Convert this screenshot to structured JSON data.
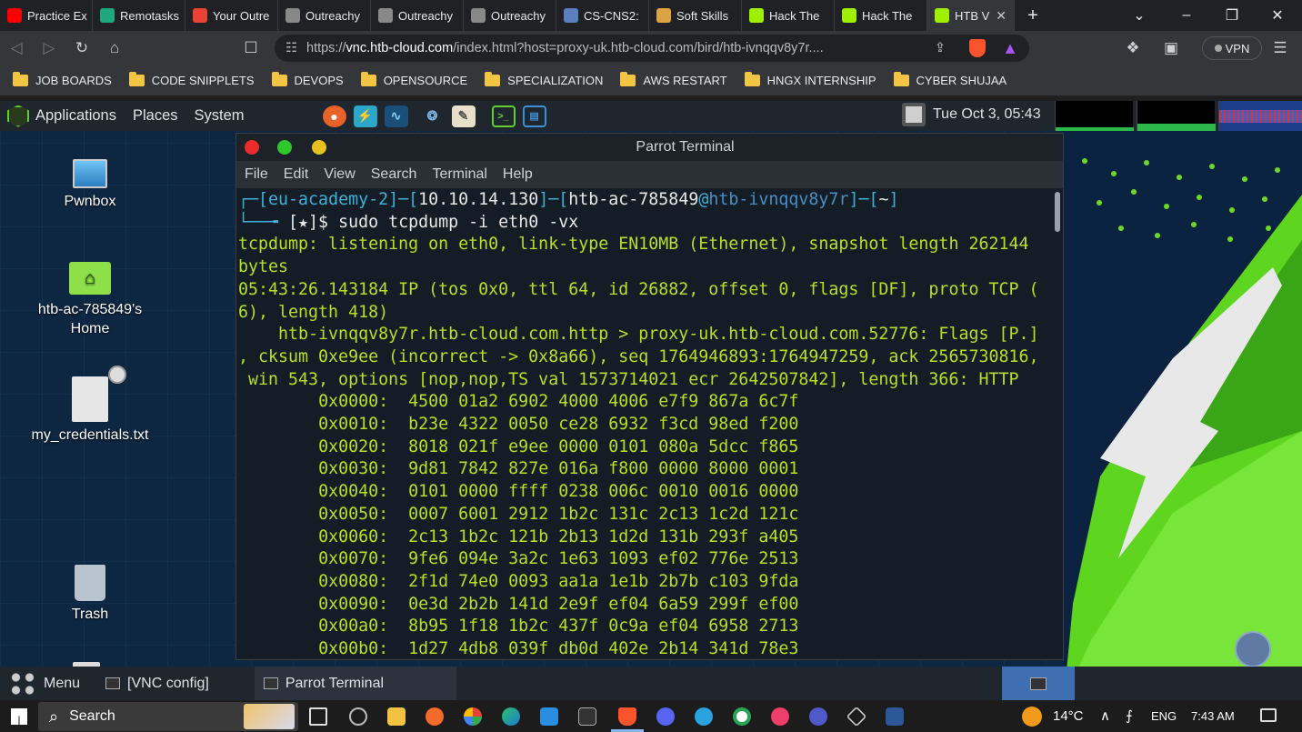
{
  "browser": {
    "tabs": [
      {
        "label": "Practice Ex",
        "icon": "youtube-icon",
        "color": "#ff0000"
      },
      {
        "label": "Remotasks",
        "icon": "remotasks-icon",
        "color": "#1fa87d"
      },
      {
        "label": "Your Outre",
        "icon": "gmail-icon",
        "color": "#ea4335"
      },
      {
        "label": "Outreachy",
        "icon": "outreachy-icon",
        "color": "#888888"
      },
      {
        "label": "Outreachy",
        "icon": "outreachy-icon",
        "color": "#888888"
      },
      {
        "label": "Outreachy",
        "icon": "outreachy-icon",
        "color": "#888888"
      },
      {
        "label": "CS-CNS2:",
        "icon": "doc-icon",
        "color": "#5b7fbf"
      },
      {
        "label": "Soft Skills",
        "icon": "doc-icon",
        "color": "#d9a441"
      },
      {
        "label": "Hack The",
        "icon": "htb-cube-icon",
        "color": "#9fef00"
      },
      {
        "label": "Hack The",
        "icon": "htb-cube-icon",
        "color": "#9fef00"
      },
      {
        "label": "HTB V",
        "icon": "htb-cube-icon",
        "color": "#9fef00",
        "active": true
      }
    ],
    "new_tab": "+",
    "url_prefix": "https://",
    "url_host": "vnc.htb-cloud.com",
    "url_rest": "/index.html?host=proxy-uk.htb-cloud.com/bird/htb-ivnqqv8y7r....",
    "vpn_label": "VPN",
    "bookmarks": [
      "JOB BOARDS",
      "CODE SNIPPLETS",
      "DEVOPS",
      "OPENSOURCE",
      "SPECIALIZATION",
      "AWS RESTART",
      "HNGX INTERNSHIP",
      "CYBER SHUJAA"
    ]
  },
  "parrot": {
    "menu": [
      "Applications",
      "Places",
      "System"
    ],
    "clock": "Tue Oct  3, 05:43",
    "desktop_icons": [
      {
        "label": "Pwnbox",
        "icon": "monitor-icon"
      },
      {
        "label": "htb-ac-785849's\nHome",
        "icon": "home-folder-icon"
      },
      {
        "label": "my_credentials.txt",
        "icon": "text-file-icon"
      },
      {
        "label": "Trash",
        "icon": "trash-icon"
      }
    ],
    "taskbar": {
      "menu_label": "Menu",
      "items": [
        "[VNC config]",
        "Parrot Terminal"
      ]
    }
  },
  "terminal": {
    "title": "Parrot Terminal",
    "menu": [
      "File",
      "Edit",
      "View",
      "Search",
      "Terminal",
      "Help"
    ],
    "prompt": {
      "academy": "eu-academy-2",
      "ip": "10.10.14.130",
      "user": "htb-ac-785849",
      "host": "htb-ivnqqv8y7r",
      "dir": "~",
      "marker": "[★]$",
      "command": "sudo tcpdump -i eth0 -vx"
    },
    "output": [
      "tcpdump: listening on eth0, link-type EN10MB (Ethernet), snapshot length 262144",
      "bytes",
      "05:43:26.143184 IP (tos 0x0, ttl 64, id 26882, offset 0, flags [DF], proto TCP (",
      "6), length 418)",
      "    htb-ivnqqv8y7r.htb-cloud.com.http > proxy-uk.htb-cloud.com.52776: Flags [P.]",
      ", cksum 0xe9ee (incorrect -> 0x8a66), seq 1764946893:1764947259, ack 2565730816,",
      " win 543, options [nop,nop,TS val 1573714021 ecr 2642507842], length 366: HTTP",
      "\t0x0000:  4500 01a2 6902 4000 4006 e7f9 867a 6c7f",
      "\t0x0010:  b23e 4322 0050 ce28 6932 f3cd 98ed f200",
      "\t0x0020:  8018 021f e9ee 0000 0101 080a 5dcc f865",
      "\t0x0030:  9d81 7842 827e 016a f800 0000 8000 0001",
      "\t0x0040:  0101 0000 ffff 0238 006c 0010 0016 0000",
      "\t0x0050:  0007 6001 2912 1b2c 131c 2c13 1c2d 121c",
      "\t0x0060:  2c13 1b2c 121b 2b13 1d2d 131b 293f a405",
      "\t0x0070:  9fe6 094e 3a2c 1e63 1093 ef02 776e 2513",
      "\t0x0080:  2f1d 74e0 0093 aa1a 1e1b 2b7b c103 9fda",
      "\t0x0090:  0e3d 2b2b 141d 2e9f ef04 6a59 299f ef00",
      "\t0x00a0:  8b95 1f18 1b2c 437f 0c9a ef04 6958 2713",
      "\t0x00b0:  1d27 4db8 039f db0d 402e 2b14 341d 78e3"
    ]
  },
  "windows": {
    "search_label": "Search",
    "weather": "14°C",
    "lang": "ENG",
    "time": "7:43 AM"
  }
}
